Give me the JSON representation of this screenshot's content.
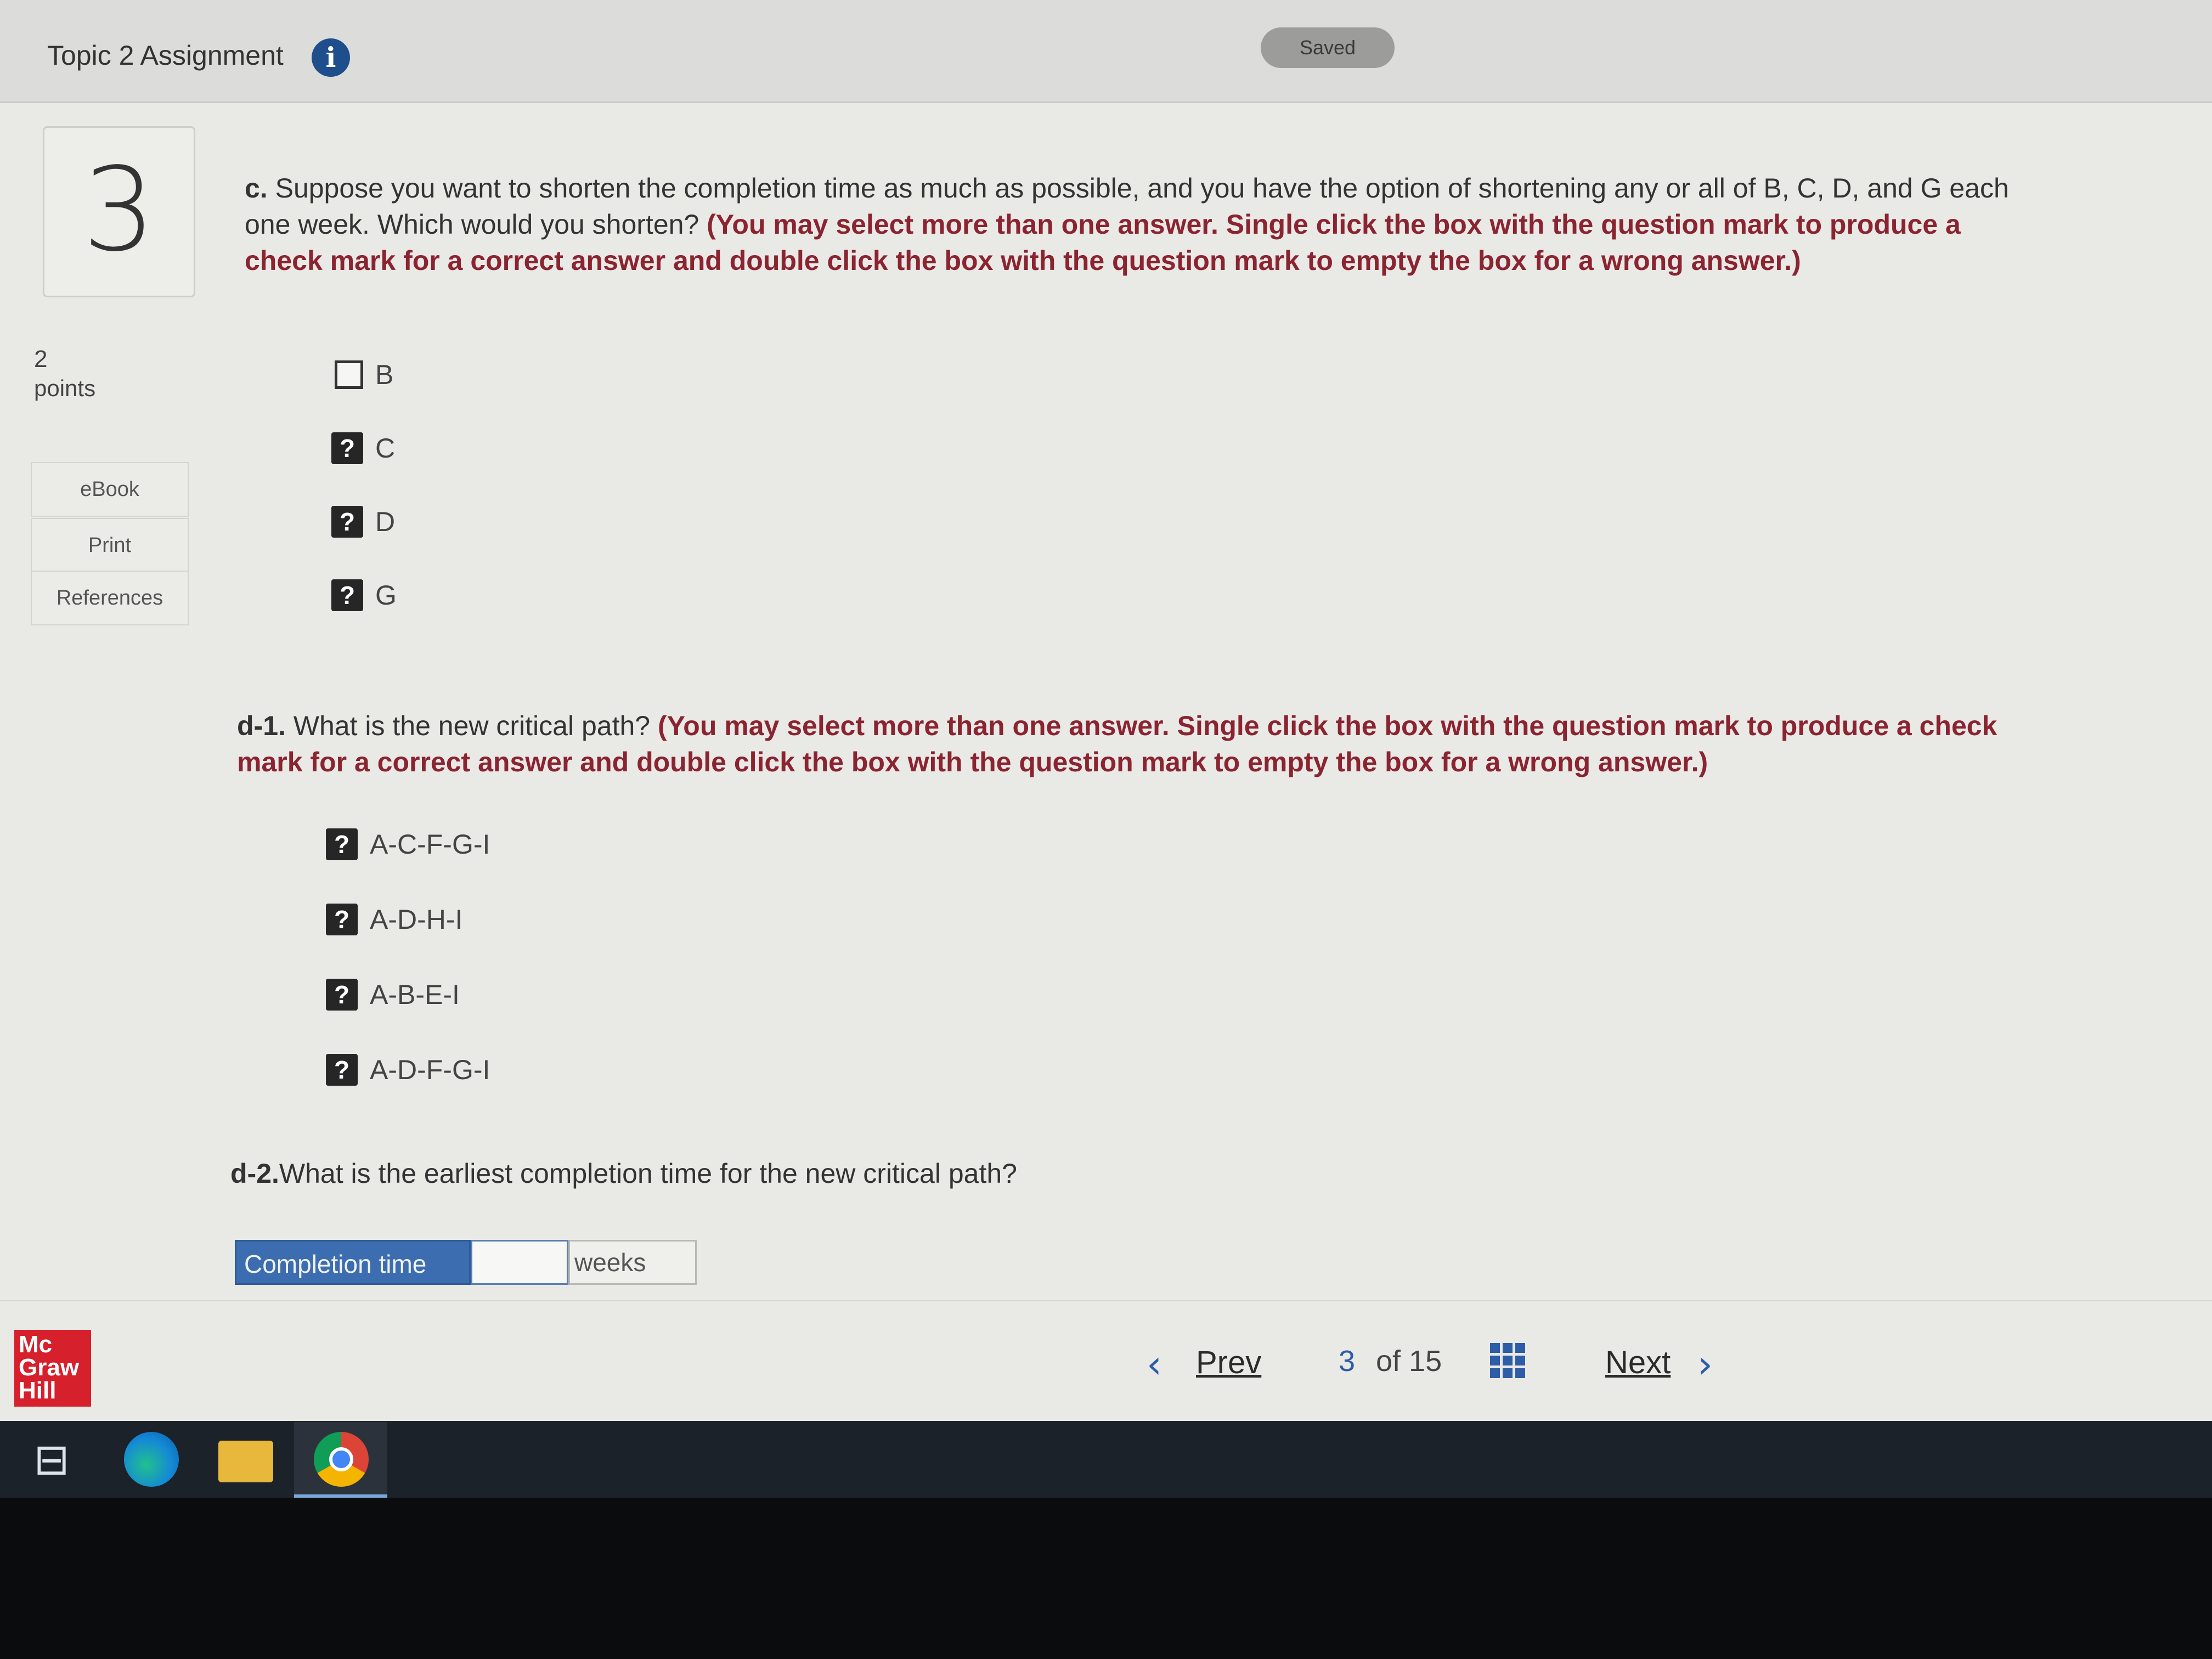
{
  "header": {
    "title": "Topic 2 Assignment",
    "info_icon": "i",
    "saved_label": "Saved"
  },
  "question": {
    "number": "3",
    "points_value": "2",
    "points_label": "points"
  },
  "sidebar": {
    "ebook": "eBook",
    "print": "Print",
    "references": "References"
  },
  "part_c": {
    "label": "c.",
    "text": " Suppose you want to shorten the completion time as much as possible, and you have the option of shortening any or all of B, C, D, and G each one week. Which would you shorten? ",
    "instruction": "(You may select more than one answer. Single click the box with the question mark to produce a check mark for a correct answer and double click the box with the question mark to empty the box for a wrong answer.)",
    "options": [
      {
        "label": "B",
        "state": "empty"
      },
      {
        "label": "C",
        "state": "question",
        "glyph": "?"
      },
      {
        "label": "D",
        "state": "question",
        "glyph": "?"
      },
      {
        "label": "G",
        "state": "question",
        "glyph": "?"
      }
    ]
  },
  "part_d1": {
    "label": "d-1.",
    "text": " What is the new critical path? ",
    "instruction": "(You may select more than one answer. Single click the box with the question mark to produce a check mark for a correct answer and double click the box with the question mark to empty the box for a wrong answer.)",
    "options": [
      {
        "label": "A-C-F-G-I",
        "glyph": "?"
      },
      {
        "label": "A-D-H-I",
        "glyph": "?"
      },
      {
        "label": "A-B-E-I",
        "glyph": "?"
      },
      {
        "label": "A-D-F-G-I",
        "glyph": "?"
      }
    ]
  },
  "part_d2": {
    "label": "d-2.",
    "text": "What is the earliest completion time for the new critical path?",
    "field_label": "Completion time",
    "field_value": "",
    "unit": "weeks"
  },
  "footer": {
    "logo_lines": [
      "Mc",
      "Graw",
      "Hill"
    ],
    "prev": "Prev",
    "page_current": "3",
    "page_of": "of 15",
    "next": "Next",
    "prev_icon": "‹",
    "next_icon": "›"
  },
  "taskbar": {
    "taskview_glyph": "⊟"
  },
  "colors": {
    "instruction": "#8b2431",
    "accent": "#2d5ca8",
    "logo": "#d6202c",
    "field_label_bg": "#3b6db0"
  }
}
